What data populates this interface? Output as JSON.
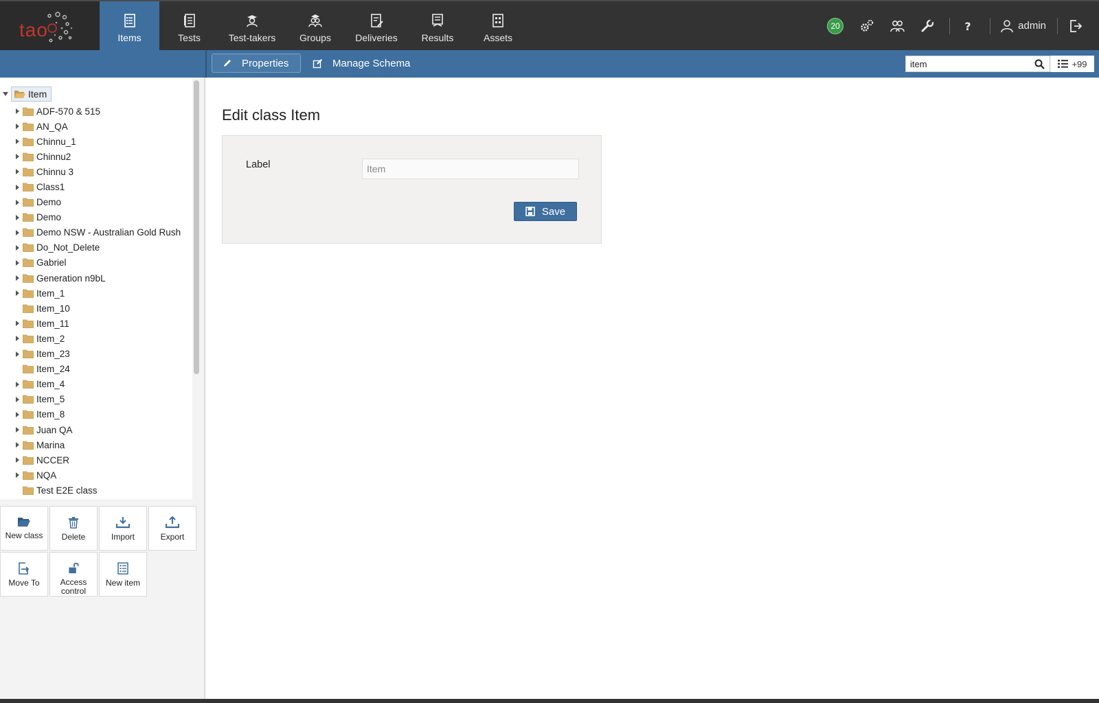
{
  "app": {
    "logo_text": "tao"
  },
  "nav": {
    "items": [
      {
        "label": "Items",
        "icon": "items-icon",
        "active": true
      },
      {
        "label": "Tests",
        "icon": "tests-icon"
      },
      {
        "label": "Test-takers",
        "icon": "test-takers-icon"
      },
      {
        "label": "Groups",
        "icon": "groups-icon"
      },
      {
        "label": "Deliveries",
        "icon": "deliveries-icon"
      },
      {
        "label": "Results",
        "icon": "results-icon"
      },
      {
        "label": "Assets",
        "icon": "assets-icon"
      }
    ]
  },
  "header": {
    "notifications_count": "20",
    "user_name": "admin",
    "icons": [
      "settings-gears-icon",
      "users-icon",
      "wrench-icon",
      "help-icon",
      "user-icon",
      "logout-icon"
    ]
  },
  "subbar": {
    "tab_properties": "Properties",
    "tab_manage_schema": "Manage Schema",
    "search_value": "item",
    "results_count": "+99"
  },
  "tree": {
    "root_label": "Item",
    "nodes": [
      {
        "label": "ADF-570 & 515",
        "expandable": true
      },
      {
        "label": "AN_QA",
        "expandable": true
      },
      {
        "label": "Chinnu_1",
        "expandable": true
      },
      {
        "label": "Chinnu2",
        "expandable": true
      },
      {
        "label": "Chinnu 3",
        "expandable": true
      },
      {
        "label": "Class1",
        "expandable": true
      },
      {
        "label": "Demo",
        "expandable": true
      },
      {
        "label": "Demo",
        "expandable": true
      },
      {
        "label": "Demo NSW - Australian Gold Rush",
        "expandable": true
      },
      {
        "label": "Do_Not_Delete",
        "expandable": true
      },
      {
        "label": "Gabriel",
        "expandable": true
      },
      {
        "label": "Generation n9bL",
        "expandable": true
      },
      {
        "label": "Item_1",
        "expandable": true
      },
      {
        "label": "Item_10",
        "expandable": false
      },
      {
        "label": "Item_11",
        "expandable": true
      },
      {
        "label": "Item_2",
        "expandable": true
      },
      {
        "label": "Item_23",
        "expandable": true
      },
      {
        "label": "Item_24",
        "expandable": false
      },
      {
        "label": "Item_4",
        "expandable": true
      },
      {
        "label": "Item_5",
        "expandable": true
      },
      {
        "label": "Item_8",
        "expandable": true
      },
      {
        "label": "Juan QA",
        "expandable": true
      },
      {
        "label": "Marina",
        "expandable": true
      },
      {
        "label": "NCCER",
        "expandable": true
      },
      {
        "label": "NQA",
        "expandable": true
      },
      {
        "label": "Test E2E class",
        "expandable": false
      }
    ]
  },
  "actions": {
    "new_class": "New class",
    "delete": "Delete",
    "import": "Import",
    "export": "Export",
    "move_to": "Move To",
    "access_control_line1": "Access",
    "access_control_line2": "control",
    "new_item": "New item"
  },
  "main": {
    "title": "Edit class Item",
    "label_field_label": "Label",
    "label_field_value": "Item",
    "save_label": "Save"
  },
  "colors": {
    "header_bg": "#333333",
    "accent_blue": "#3e6f9e",
    "brand_red": "#c2362c",
    "folder": "#d9b166",
    "badge_green": "#3b9b4b"
  }
}
